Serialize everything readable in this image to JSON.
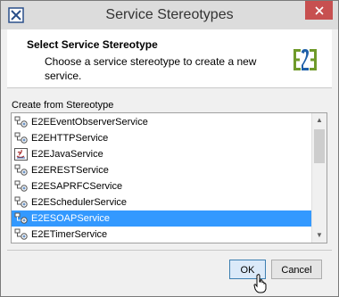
{
  "window": {
    "title": "Service Stereotypes"
  },
  "header": {
    "title": "Select Service Stereotype",
    "description": "Choose a service stereotype to create a new service."
  },
  "section_label": "Create from Stereotype",
  "list": {
    "items": [
      {
        "label": "E2EEventObserverService",
        "icon": "stereotype-icon",
        "selected": false
      },
      {
        "label": "E2EHTTPService",
        "icon": "stereotype-icon",
        "selected": false
      },
      {
        "label": "E2EJavaService",
        "icon": "java-icon",
        "selected": false
      },
      {
        "label": "E2ERESTService",
        "icon": "stereotype-icon",
        "selected": false
      },
      {
        "label": "E2ESAPRFCService",
        "icon": "stereotype-icon",
        "selected": false
      },
      {
        "label": "E2ESchedulerService",
        "icon": "stereotype-icon",
        "selected": false
      },
      {
        "label": "E2ESOAPService",
        "icon": "stereotype-icon",
        "selected": true
      },
      {
        "label": "E2ETimerService",
        "icon": "stereotype-icon",
        "selected": false
      }
    ]
  },
  "buttons": {
    "ok": "OK",
    "cancel": "Cancel"
  },
  "colors": {
    "selection": "#3399ff",
    "close": "#c75050",
    "logo_green": "#6f9a2a",
    "logo_blue": "#1f5fa8"
  }
}
